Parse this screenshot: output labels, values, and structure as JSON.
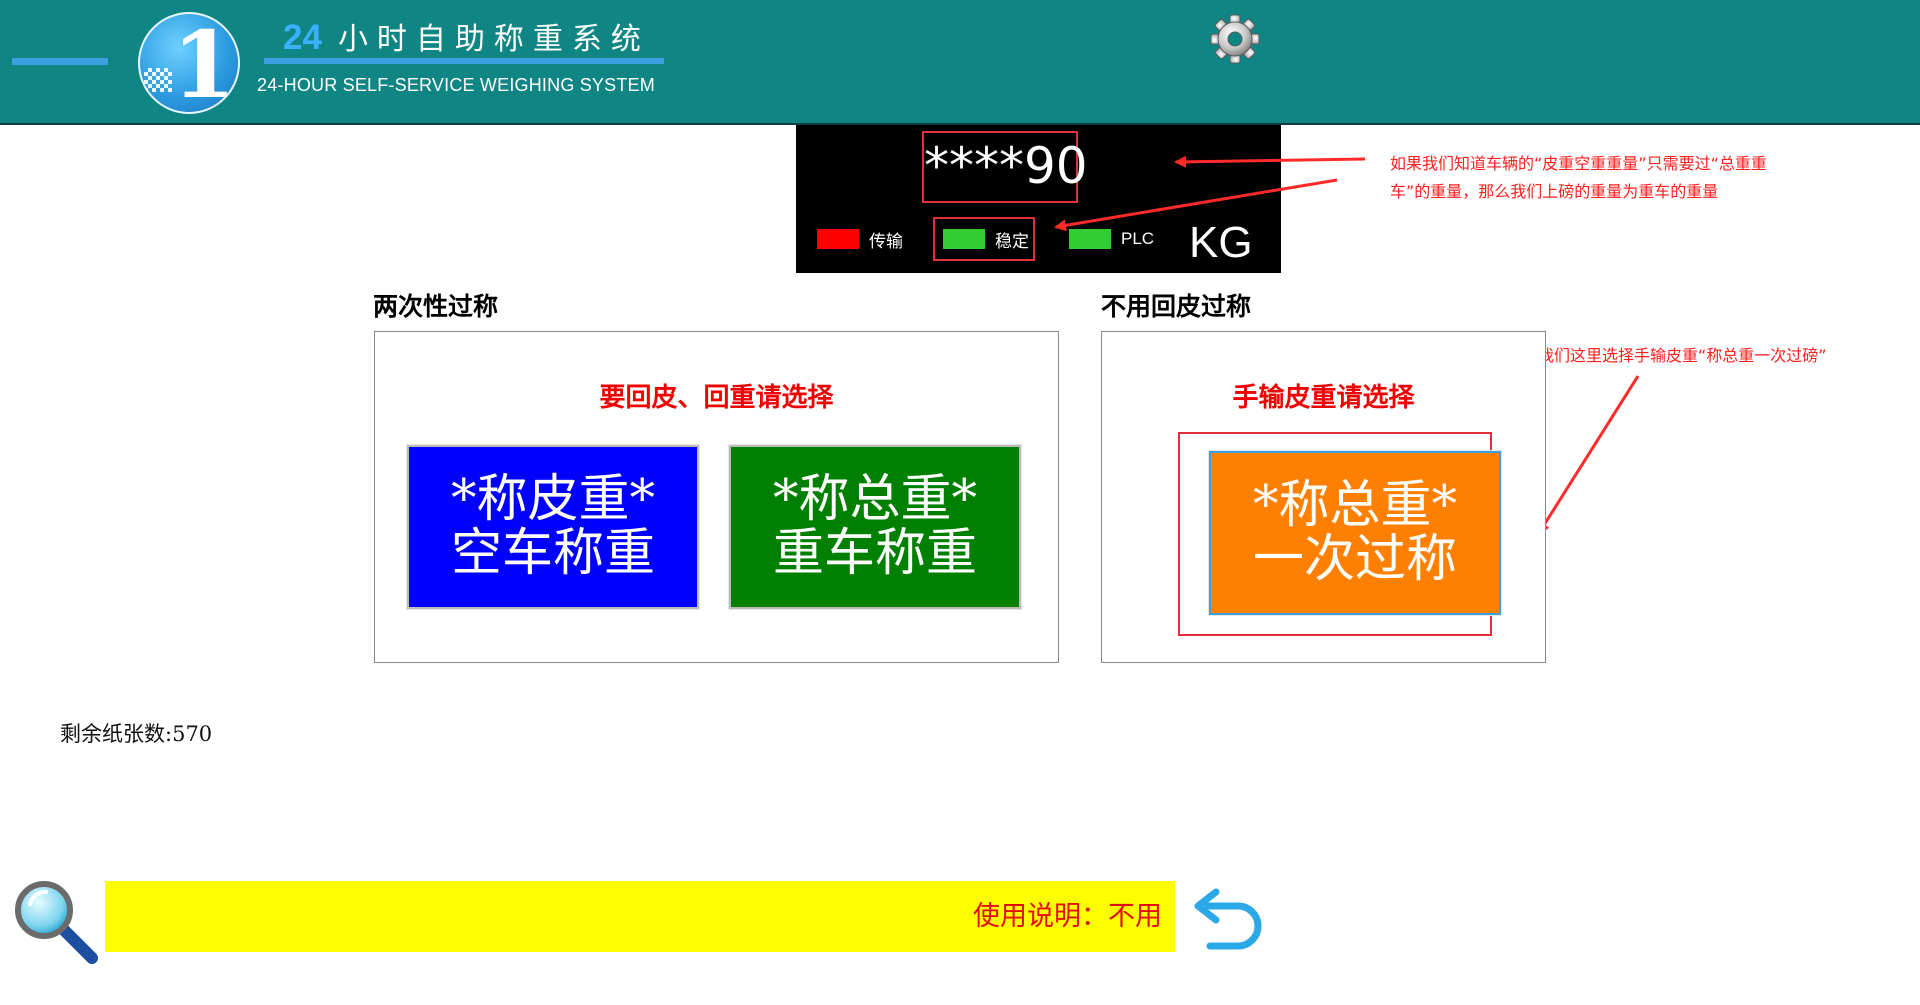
{
  "header": {
    "logo_numeral": "1",
    "title_number": "24",
    "title_cn": "小时自助称重系统",
    "title_en": "24-HOUR SELF-SERVICE WEIGHING SYSTEM",
    "settings_icon": "gear-icon"
  },
  "display": {
    "weight": "****90",
    "unit": "KG",
    "indicators": [
      {
        "label": "传输",
        "color": "#ff0000"
      },
      {
        "label": "稳定",
        "color": "#33cc33"
      },
      {
        "label": "PLC",
        "color": "#33cc33"
      }
    ]
  },
  "annotations": {
    "top_note": [
      "如果我们知道车辆的“皮重空重重量”只需要过“总重重",
      "车”的重量，那么我们上磅的重量为重车的重量"
    ],
    "right_note": "我们这里选择手输皮重“称总重一次过磅”"
  },
  "panels": {
    "two_pass": {
      "title": "两次性过称",
      "caption": "要回皮、回重请选择",
      "tare_button": {
        "line1": "*称皮重*",
        "line2": "空车称重",
        "color": "#0000ff"
      },
      "gross_button": {
        "line1": "*称总重*",
        "line2": "重车称重",
        "color": "#008000"
      }
    },
    "no_tare": {
      "title": "不用回皮过称",
      "caption": "手输皮重请选择",
      "button": {
        "line1": "*称总重*",
        "line2": "一次过称",
        "color": "#ff8000"
      }
    }
  },
  "footer": {
    "paper_label": "剩余纸张数:",
    "paper_count": "570",
    "search_icon": "magnifier-icon",
    "marquee_text": "使用说明：不用",
    "back_icon": "back-arrow-icon"
  },
  "colors": {
    "header_bg": "#0f8584",
    "accent_blue": "#3aa0e0",
    "highlight_red": "#e0303a",
    "marquee_bg": "#ffff00"
  }
}
